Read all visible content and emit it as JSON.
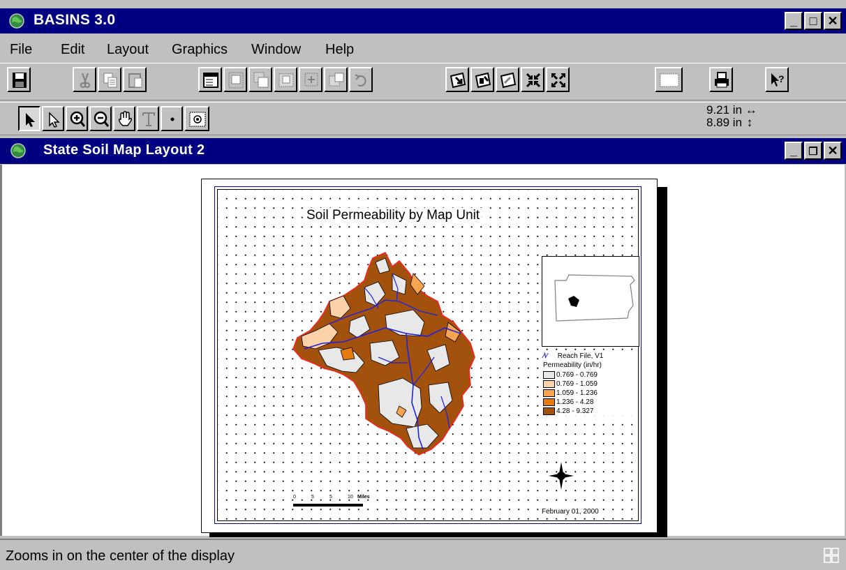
{
  "app": {
    "title": "BASINS 3.0"
  },
  "menubar": {
    "items": [
      "File",
      "Edit",
      "Layout",
      "Graphics",
      "Window",
      "Help"
    ]
  },
  "toolbar1": {
    "buttons": [
      "save",
      "cut",
      "copy",
      "paste",
      "properties",
      "group",
      "ungroup",
      "bring-to-front",
      "send-to-back",
      "undo",
      "zoom-to-page",
      "zoom-to-extent",
      "zoom-actual",
      "zoom-in-page",
      "zoom-out-page",
      "select-all",
      "print",
      "help"
    ]
  },
  "toolbar2": {
    "tools": [
      "pointer",
      "vertex-edit",
      "zoom-in",
      "zoom-out",
      "pan",
      "text",
      "symbol",
      "frame"
    ],
    "width_readout": "9.21 in",
    "height_readout": "8.89 in"
  },
  "layout_window": {
    "title": "State Soil Map Layout 2"
  },
  "map": {
    "title": "Soil Permeability by Map Unit",
    "legend": {
      "reach_label": "Reach File, V1",
      "permeability_label": "Permeability (in/hr)",
      "classes": [
        {
          "label": "0.769 - 0.769",
          "color": "#e8e8e8"
        },
        {
          "label": "0.769 - 1.059",
          "color": "#fcd3a8"
        },
        {
          "label": "1.059 - 1.236",
          "color": "#f7a551"
        },
        {
          "label": "1.236 - 4.28",
          "color": "#e47a10"
        },
        {
          "label": "4.28 - 9.327",
          "color": "#a3520e"
        }
      ]
    },
    "scalebar_label": "Miles",
    "scalebar_ticks": [
      "0",
      "5",
      "5",
      "10"
    ],
    "date": "February 01, 2000"
  },
  "status": {
    "text": "Zooms in on the center of the display"
  }
}
